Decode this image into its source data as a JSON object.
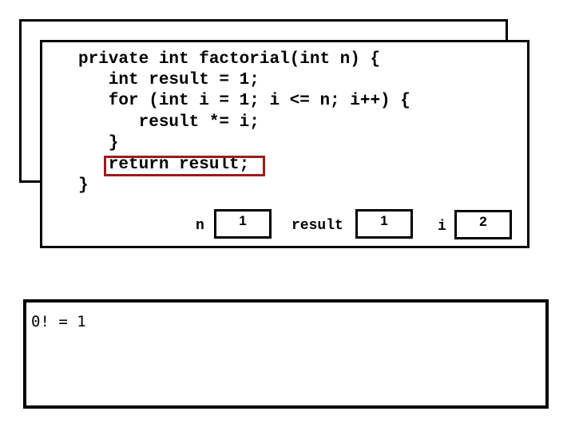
{
  "code": {
    "lines": [
      "private int factorial(int n) {",
      "   int result = 1;",
      "   for (int i = 1; i <= n; i++) {",
      "      result *= i;",
      "   }",
      "   return result;",
      "}"
    ],
    "highlighted_line_index": 5,
    "highlight_color": "#9b1c1c"
  },
  "variables": [
    {
      "name": "n",
      "value": "1"
    },
    {
      "name": "result",
      "value": "1"
    },
    {
      "name": "i",
      "value": "2"
    }
  ],
  "output": {
    "text": "0! = 1"
  }
}
